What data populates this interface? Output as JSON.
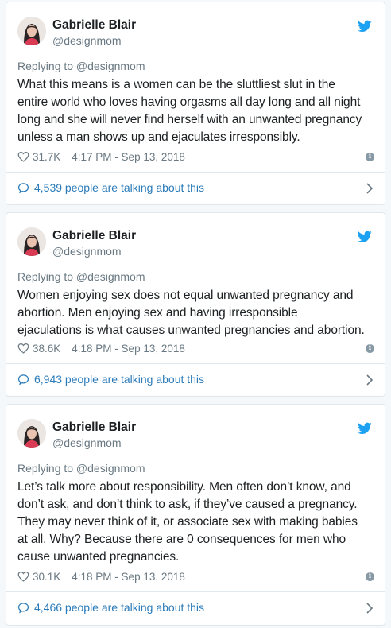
{
  "tweets": [
    {
      "name": "Gabrielle Blair",
      "handle": "@designmom",
      "reply": "Replying to @designmom",
      "lines": [
        "What this means is a women can be the sluttliest slut in the",
        "entire world who loves having orgasms all day long and all night",
        "long and she will never find herself with an unwanted pregnancy",
        "unless a man shows up and ejaculates irresponsibly."
      ],
      "likes": "31.7K",
      "time": "4:17 PM - Sep 13, 2018",
      "talking": "4,539 people are talking about this"
    },
    {
      "name": "Gabrielle Blair",
      "handle": "@designmom",
      "reply": "Replying to @designmom",
      "lines": [
        "Women enjoying sex does not equal unwanted pregnancy and",
        "abortion. Men enjoying sex and having irresponsible",
        "ejaculations is what causes unwanted pregnancies and abortion."
      ],
      "likes": "38.6K",
      "time": "4:18 PM - Sep 13, 2018",
      "talking": "6,943 people are talking about this"
    },
    {
      "name": "Gabrielle Blair",
      "handle": "@designmom",
      "reply": "Replying to @designmom",
      "lines": [
        "Let’s talk more about responsibility. Men often don’t know, and",
        "don’t ask, and don’t think to ask, if they’ve caused a pregnancy.",
        "They may never think of it, or associate sex with making babies",
        "at all. Why? Because there are 0 consequences for men who",
        "cause unwanted pregnancies."
      ],
      "likes": "30.1K",
      "time": "4:18 PM - Sep 13, 2018",
      "talking": "4,466 people are talking about this"
    }
  ],
  "colors": {
    "link": "#2b7bb9",
    "twitter": "#1da1f2",
    "muted": "#697882"
  },
  "icons": [
    "twitter-bird-icon",
    "heart-icon",
    "info-icon",
    "speech-bubble-icon",
    "chevron-right-icon"
  ]
}
